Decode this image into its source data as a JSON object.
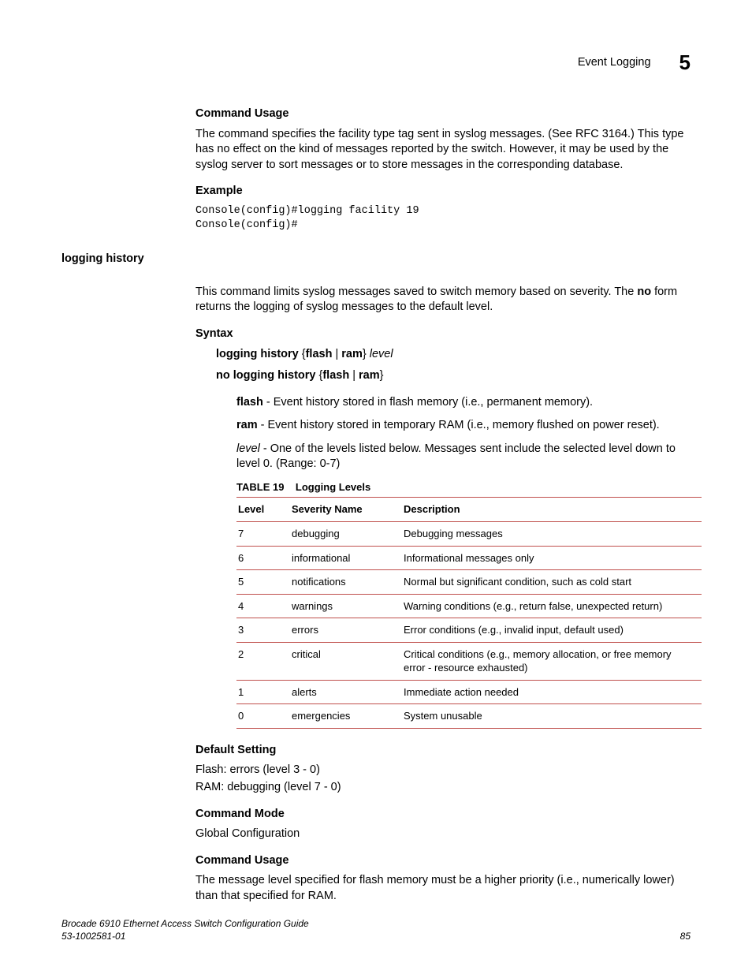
{
  "header": {
    "section": "Event Logging",
    "chapter": "5"
  },
  "block1": {
    "usage_h": "Command Usage",
    "usage_p": "The command specifies the facility type tag sent in syslog messages. (See RFC 3164.) This type has no effect on the kind of messages reported by the switch. However, it may be used by the syslog server to sort messages or to store messages in the corresponding database.",
    "example_h": "Example",
    "example_code": "Console(config)#logging facility 19\nConsole(config)#"
  },
  "sidehead": "logging history",
  "block2": {
    "intro_pre": "This command limits syslog messages saved to switch memory based on severity. The ",
    "intro_bold": "no",
    "intro_post": " form returns the logging of syslog messages to the default level.",
    "syntax_h": "Syntax",
    "syntax_line1_b1": "logging history",
    "syntax_line1_mid": " {",
    "syntax_line1_b2": "flash",
    "syntax_line1_pipe": " | ",
    "syntax_line1_b3": "ram",
    "syntax_line1_close": "} ",
    "syntax_line1_it": "level",
    "syntax_line2_b1": "no logging history",
    "syntax_line2_mid": " {",
    "syntax_line2_b2": "flash",
    "syntax_line2_pipe": " | ",
    "syntax_line2_b3": "ram",
    "syntax_line2_close": "}",
    "param_flash_b": "flash",
    "param_flash_t": " - Event history stored in flash memory (i.e., permanent memory).",
    "param_ram_b": "ram",
    "param_ram_t": " - Event history stored in temporary RAM (i.e., memory flushed on power reset).",
    "param_level_it": "level",
    "param_level_t": " - One of the levels listed below. Messages sent include the selected level down to level 0. (Range: 0-7)",
    "table_num": "TABLE 19",
    "table_title": "Logging Levels",
    "th_level": "Level",
    "th_name": "Severity Name",
    "th_desc": "Description",
    "rows": [
      {
        "lvl": "7",
        "name": "debugging",
        "desc": "Debugging messages"
      },
      {
        "lvl": "6",
        "name": "informational",
        "desc": "Informational messages only"
      },
      {
        "lvl": "5",
        "name": "notifications",
        "desc": "Normal but significant condition, such as cold start"
      },
      {
        "lvl": "4",
        "name": "warnings",
        "desc": "Warning conditions (e.g., return false, unexpected return)"
      },
      {
        "lvl": "3",
        "name": "errors",
        "desc": "Error conditions (e.g., invalid input, default used)"
      },
      {
        "lvl": "2",
        "name": "critical",
        "desc": "Critical conditions (e.g., memory allocation, or free memory error - resource exhausted)"
      },
      {
        "lvl": "1",
        "name": "alerts",
        "desc": "Immediate action needed"
      },
      {
        "lvl": "0",
        "name": "emergencies",
        "desc": "System unusable"
      }
    ],
    "default_h": "Default Setting",
    "default_l1": "Flash: errors (level 3 - 0)",
    "default_l2": "RAM: debugging (level 7 - 0)",
    "mode_h": "Command Mode",
    "mode_p": "Global Configuration",
    "usage2_h": "Command Usage",
    "usage2_p": "The message level specified for flash memory must be a higher priority (i.e., numerically lower) than that specified for RAM."
  },
  "footer": {
    "line1": "Brocade 6910 Ethernet Access Switch Configuration Guide",
    "line2": "53-1002581-01",
    "pagenum": "85"
  }
}
